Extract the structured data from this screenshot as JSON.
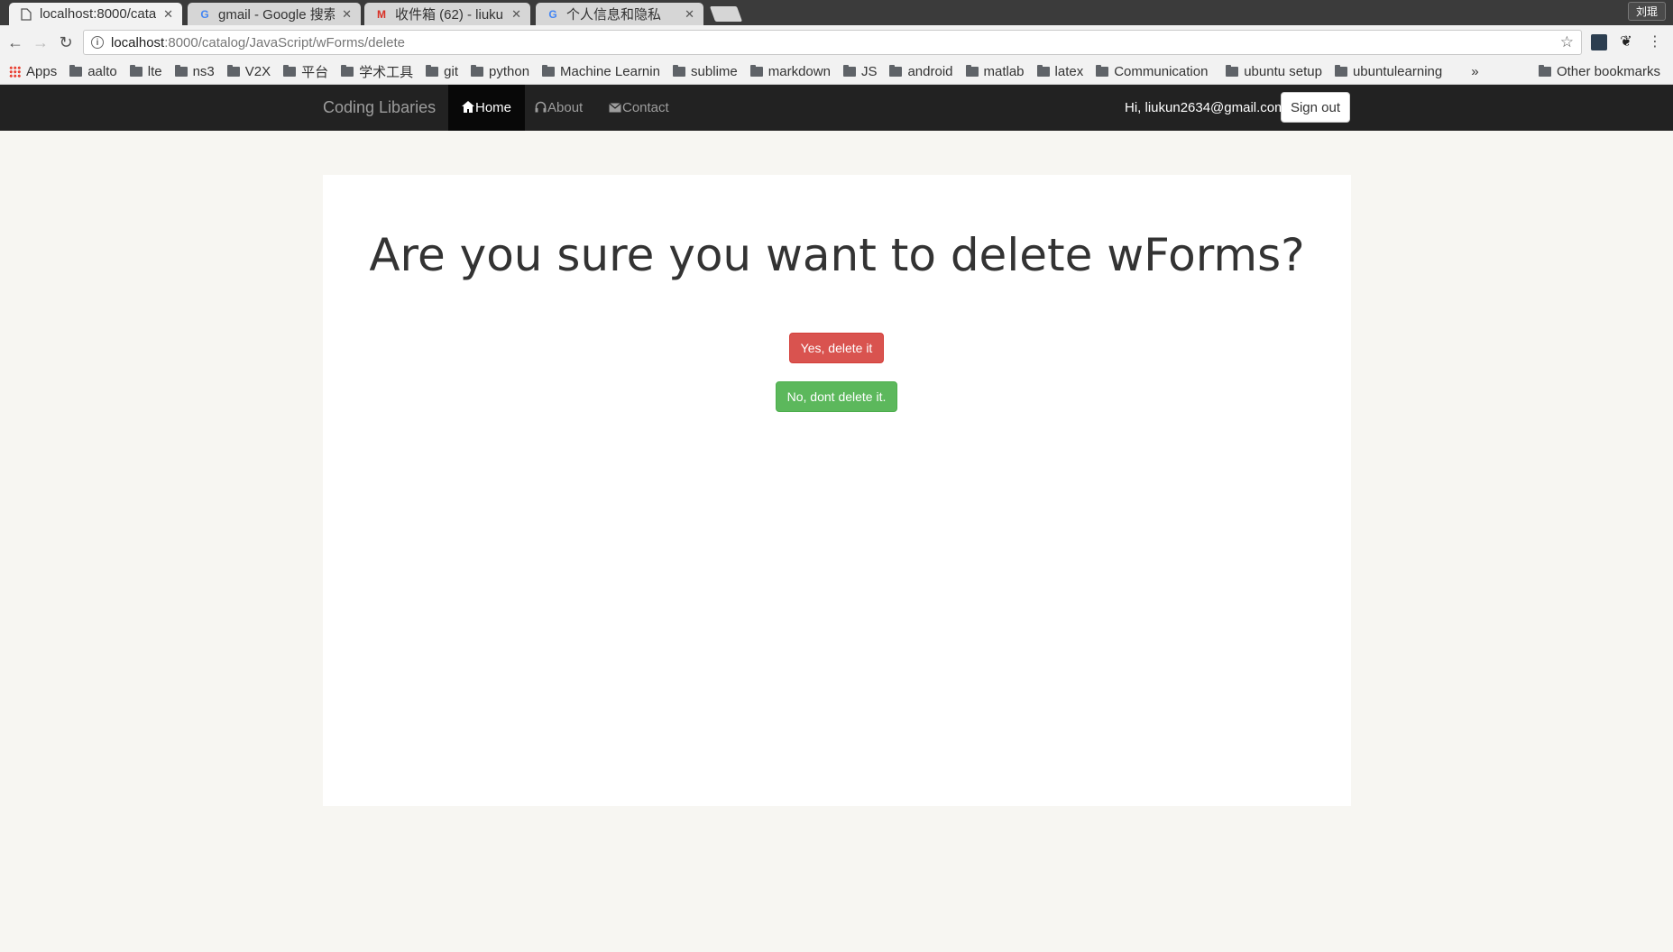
{
  "browser": {
    "tabs": [
      {
        "title": "localhost:8000/cata",
        "icon": "page-icon",
        "active": true
      },
      {
        "title": "gmail - Google 搜索",
        "icon": "google-icon",
        "active": false
      },
      {
        "title": "收件箱 (62) - liukun",
        "icon": "gmail-icon",
        "active": false
      },
      {
        "title": "个人信息和隐私",
        "icon": "google-icon",
        "active": false
      }
    ],
    "profile_name": "刘琨",
    "url_host": "localhost",
    "url_path": ":8000/catalog/JavaScript/wForms/delete",
    "bookmarks": [
      "Apps",
      "aalto",
      "lte",
      "ns3",
      "V2X",
      "平台",
      "学术工具",
      "git",
      "python",
      "Machine Learnin",
      "sublime",
      "markdown",
      "JS",
      "android",
      "matlab",
      "latex",
      "Communication",
      "ubuntu setup",
      "ubuntulearning"
    ],
    "bookmarks_overflow": "»",
    "other_bookmarks": "Other bookmarks"
  },
  "navbar": {
    "brand": "Coding Libaries",
    "items": [
      {
        "label": "Home",
        "icon": "home-icon",
        "glyph": "⌂",
        "active": true
      },
      {
        "label": "About",
        "icon": "headphones-icon",
        "glyph": "🎧",
        "active": false
      },
      {
        "label": "Contact",
        "icon": "envelope-icon",
        "glyph": "✉",
        "active": false
      }
    ],
    "greeting": "Hi, liukun2634@gmail.com",
    "signout_label": "Sign out"
  },
  "main": {
    "heading": "Are you sure you want to delete wForms?",
    "confirm_label": "Yes, delete it",
    "cancel_label": "No, dont delete it."
  },
  "colors": {
    "danger": "#d9534f",
    "success": "#5cb85c",
    "navbar_bg": "#222222",
    "page_bg": "#f7f6f2"
  }
}
